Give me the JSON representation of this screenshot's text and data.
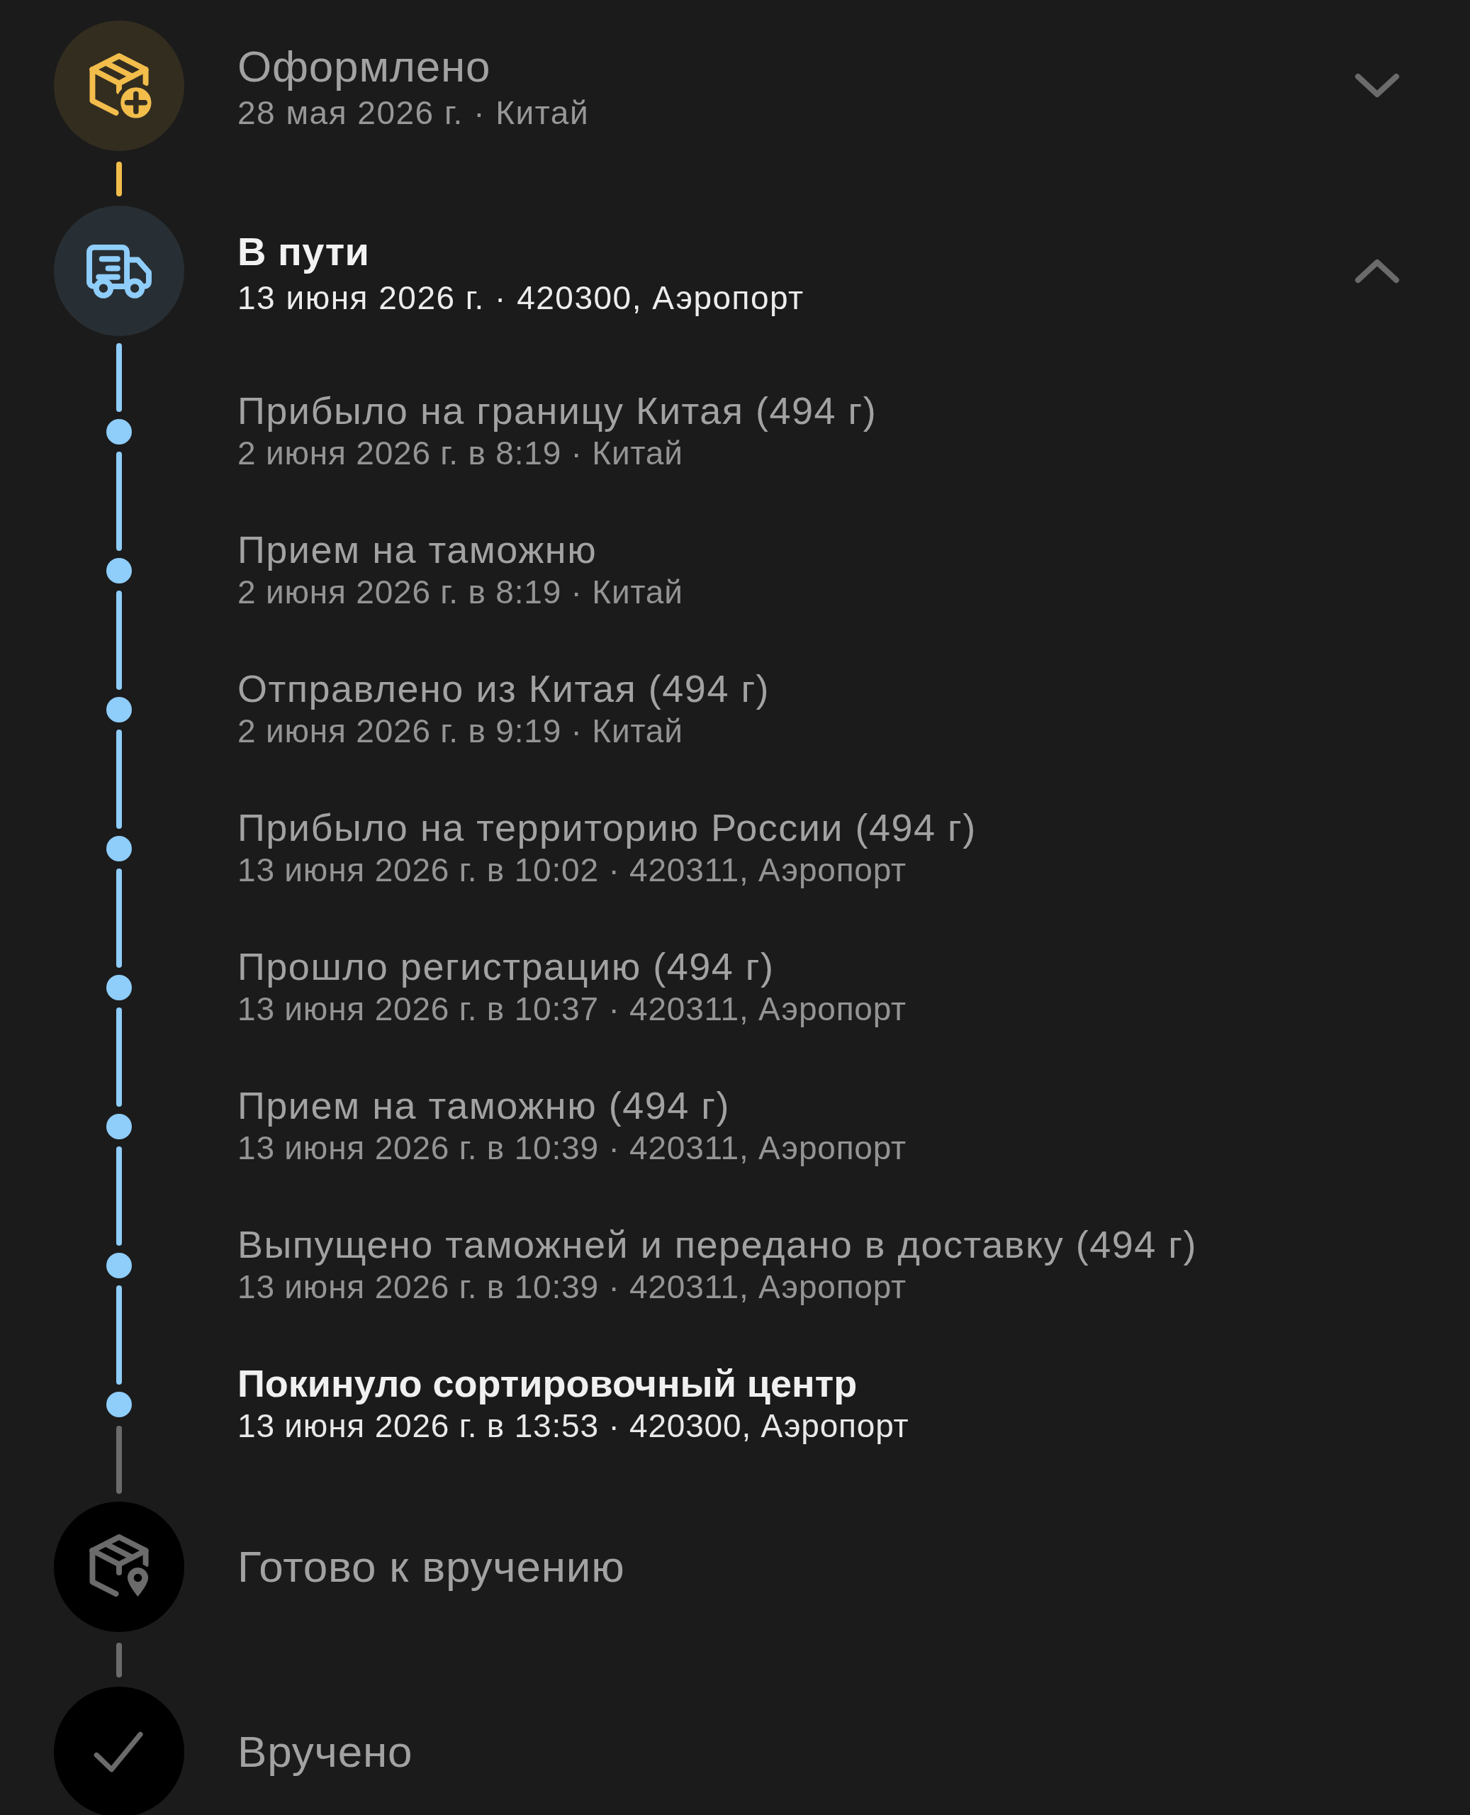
{
  "stages": [
    {
      "kind": "registered",
      "title": "Оформлено",
      "subtitle": "28 мая 2026 г. · Китай",
      "color": "#f2bd4b",
      "reached": true,
      "current": false,
      "expanded": false
    },
    {
      "kind": "in_transit",
      "title": "В пути",
      "subtitle": "13 июня 2026 г. · 420300, Аэропорт",
      "color": "#8fcdfa",
      "reached": true,
      "current": true,
      "expanded": true,
      "events": [
        {
          "title": "Прибыло на границу Китая (494 г)",
          "subtitle": "2 июня 2026 г. в 8:19 · Китай",
          "current": false
        },
        {
          "title": "Прием на таможню",
          "subtitle": "2 июня 2026 г. в 8:19 · Китай",
          "current": false
        },
        {
          "title": "Отправлено из Китая (494 г)",
          "subtitle": "2 июня 2026 г. в 9:19 · Китай",
          "current": false
        },
        {
          "title": "Прибыло на территорию России (494 г)",
          "subtitle": "13 июня 2026 г. в 10:02 · 420311, Аэропорт",
          "current": false
        },
        {
          "title": "Прошло регистрацию (494 г)",
          "subtitle": "13 июня 2026 г. в 10:37 · 420311, Аэропорт",
          "current": false
        },
        {
          "title": "Прием на таможню (494 г)",
          "subtitle": "13 июня 2026 г. в 10:39 · 420311, Аэропорт",
          "current": false
        },
        {
          "title": "Выпущено таможней и передано в доставку (494 г)",
          "subtitle": "13 июня 2026 г. в 10:39 · 420311, Аэропорт",
          "current": false
        },
        {
          "title": "Покинуло сортировочный центр",
          "subtitle": "13 июня 2026 г. в 13:53 · 420300, Аэропорт",
          "current": true
        }
      ]
    },
    {
      "kind": "ready",
      "title": "Готово к вручению",
      "color": "#6b6b6b",
      "reached": false,
      "current": false
    },
    {
      "kind": "delivered",
      "title": "Вручено",
      "color": "#6b6b6b",
      "reached": false,
      "current": false
    }
  ]
}
